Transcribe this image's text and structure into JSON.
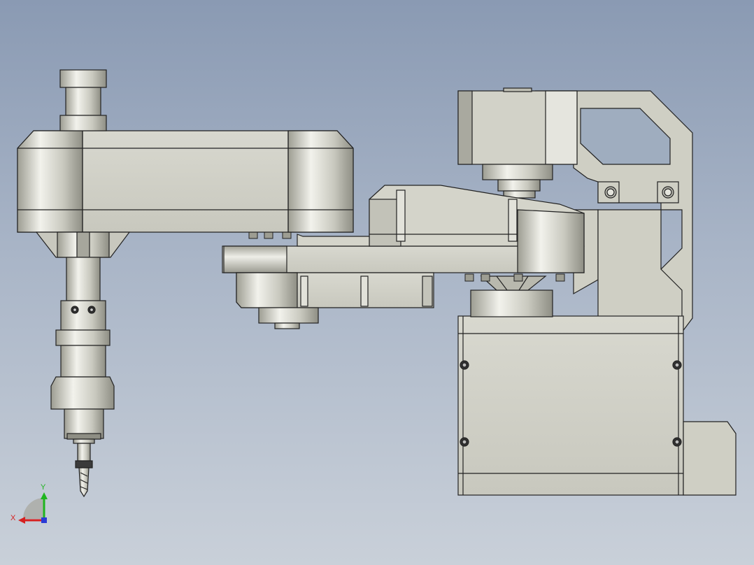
{
  "viewport": {
    "background_top": "#8a9ab3",
    "background_bottom": "#c9d0d9",
    "part_color": "#cfcfc4",
    "edge_color": "#222222"
  },
  "triad": {
    "x_label": "X",
    "y_label": "Y",
    "x_color": "#d62020",
    "y_color": "#1fb51f",
    "z_color": "#2a3bd6"
  }
}
